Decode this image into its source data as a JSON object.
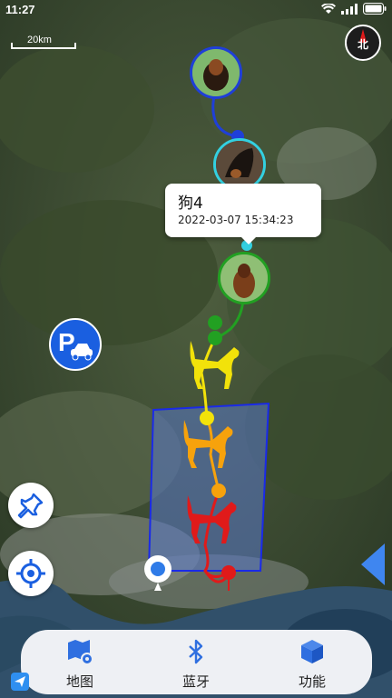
{
  "status_bar": {
    "time": "11:27"
  },
  "map": {
    "scale_label": "20km",
    "compass_label": "北",
    "colors": {
      "route_top": "#1f3fd8",
      "route_green": "#22a022",
      "route_yellow": "#f2e20a",
      "route_orange": "#f7a20c",
      "route_red": "#e01a1a",
      "geofence_fill": "#5a78c8",
      "geofence_border": "#1a2ae8"
    }
  },
  "tooltip": {
    "name": "狗4",
    "datetime": "2022-03-07 15:34:23"
  },
  "bottom_nav": {
    "items": [
      {
        "label": "地图",
        "icon": "map-settings-icon"
      },
      {
        "label": "蓝牙",
        "icon": "bluetooth-icon"
      },
      {
        "label": "功能",
        "icon": "box-icon"
      }
    ]
  }
}
